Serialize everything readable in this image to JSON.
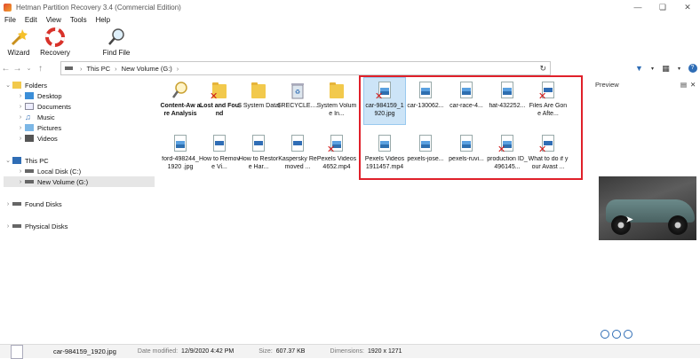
{
  "window": {
    "title": "Hetman Partition Recovery 3.4 (Commercial Edition)"
  },
  "menu": [
    "File",
    "Edit",
    "View",
    "Tools",
    "Help"
  ],
  "toolbar": {
    "wizard": "Wizard",
    "recovery": "Recovery",
    "find_file": "Find File"
  },
  "address": {
    "segments": [
      "This PC",
      "New Volume (G:)"
    ]
  },
  "tree": {
    "folders": "Folders",
    "desktop": "Desktop",
    "documents": "Documents",
    "music": "Music",
    "pictures": "Pictures",
    "videos": "Videos",
    "this_pc": "This PC",
    "local_disk": "Local Disk (C:)",
    "new_volume": "New Volume (G:)",
    "found_disks": "Found Disks",
    "physical_disks": "Physical Disks"
  },
  "files": [
    {
      "label": "Content-Aw are Analysis",
      "icon": "search-icon",
      "bold": true,
      "deleted": false
    },
    {
      "label": "Lost and Found",
      "icon": "folder-icon",
      "bold": true,
      "deleted": true
    },
    {
      "label": "$ System Data",
      "icon": "folder-icon",
      "bold": false,
      "deleted": false
    },
    {
      "label": "$RECYCLE....",
      "icon": "recycle-bin-icon",
      "bold": false,
      "deleted": false
    },
    {
      "label": "System Volume In...",
      "icon": "folder-icon",
      "bold": false,
      "deleted": false
    },
    {
      "label": "car-984159_1 920.jpg",
      "icon": "image-icon",
      "bold": false,
      "deleted": true,
      "selected": true
    },
    {
      "label": "car-130062...",
      "icon": "image-icon",
      "bold": false,
      "deleted": false
    },
    {
      "label": "car-race-4...",
      "icon": "image-icon",
      "bold": false,
      "deleted": false
    },
    {
      "label": "fiat-432252...",
      "icon": "image-icon",
      "bold": false,
      "deleted": false
    },
    {
      "label": "Files Are Gone Afte...",
      "icon": "document-icon",
      "bold": false,
      "deleted": true
    },
    {
      "label": "ford-498244_ 1920 .jpg",
      "icon": "image-icon",
      "bold": false,
      "deleted": false
    },
    {
      "label": "How to Remove Vi...",
      "icon": "document-icon",
      "bold": false,
      "deleted": false
    },
    {
      "label": "How to Restore Har...",
      "icon": "document-icon",
      "bold": false,
      "deleted": false
    },
    {
      "label": "Kaspersky Removed ...",
      "icon": "document-icon",
      "bold": false,
      "deleted": false
    },
    {
      "label": "Pexels Videos 4652.mp4",
      "icon": "video-icon",
      "bold": false,
      "deleted": true
    },
    {
      "label": "Pexels Videos 1911457.mp4",
      "icon": "video-icon",
      "bold": false,
      "deleted": false
    },
    {
      "label": "pexels-jose...",
      "icon": "image-icon",
      "bold": false,
      "deleted": false
    },
    {
      "label": "pexels-ruvi...",
      "icon": "image-icon",
      "bold": false,
      "deleted": false
    },
    {
      "label": "production ID_496145...",
      "icon": "video-icon",
      "bold": false,
      "deleted": true
    },
    {
      "label": "What to do if your Avast ...",
      "icon": "document-icon",
      "bold": false,
      "deleted": true
    }
  ],
  "preview": {
    "title": "Preview"
  },
  "status": {
    "filename": "car-984159_1920.jpg",
    "date_key": "Date modified:",
    "date_val": "12/9/2020 4:42 PM",
    "size_key": "Size:",
    "size_val": "607.37 KB",
    "dim_key": "Dimensions:",
    "dim_val": "1920 x 1271"
  },
  "colors": {
    "highlight_box": "#e0202a",
    "selection": "#cce4f7",
    "accent": "#2f6db5"
  }
}
